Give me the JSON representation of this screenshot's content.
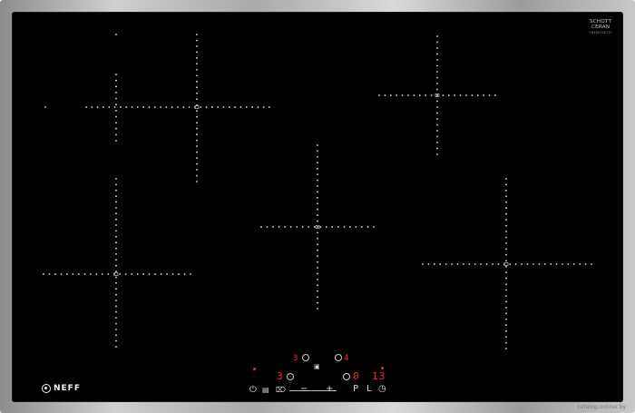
{
  "brand": {
    "ceran_line1": "SCHOTT",
    "ceran_line2": "CERAN",
    "ceran_small": "THEMOSETIC",
    "logo_text": "NEFF"
  },
  "controls": {
    "zone_display_top_left": "3",
    "zone_display_top_right": "4",
    "zone_display_bottom_left": "3",
    "zone_display_bottom_mid": "0",
    "timer_display": "13",
    "power_label": "⏻",
    "minus_label": "−",
    "plus_label": "+",
    "p_label": "P",
    "l_label": "L",
    "clock_label": "◷"
  },
  "watermark": "catalog.onliner.by",
  "colors": {
    "glass": "#000000",
    "frame": "#b5b5b5",
    "display": "#ff2a2a",
    "markings": "#e6e6e6"
  }
}
